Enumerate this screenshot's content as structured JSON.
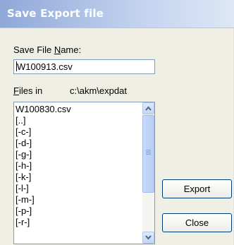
{
  "window": {
    "title": "Save Export file"
  },
  "save_file_name": {
    "label_before": "Save File ",
    "label_accel": "N",
    "label_after": "ame:",
    "value": "W100913.csv"
  },
  "files_in": {
    "label_accel": "F",
    "label_after": "iles in",
    "path": "c:\\akm\\expdat"
  },
  "file_list": {
    "items": [
      "W100830.csv",
      "[..]",
      "[-c-]",
      "[-d-]",
      "[-g-]",
      "[-h-]",
      "[-k-]",
      "[-l-]",
      "[-m-]",
      "[-p-]",
      "[-r-]"
    ]
  },
  "buttons": {
    "export": "Export",
    "close": "Close"
  },
  "icons": {
    "scroll_up": "chevron-up-icon",
    "scroll_down": "chevron-down-icon"
  },
  "colors": {
    "title_gradient_start": "#8fa8d8",
    "title_text": "#ffffff",
    "window_bg": "#f0efe6"
  }
}
